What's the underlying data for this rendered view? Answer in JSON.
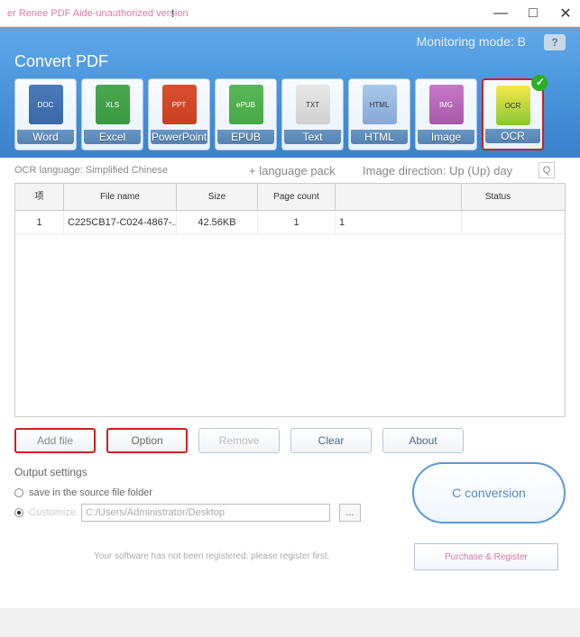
{
  "title": "er Renee PDF Aide-unauthorized version",
  "title_mark": "!",
  "monitor_mode": "Monitoring mode: B",
  "help_icon": "?",
  "convert_title": "Convert PDF",
  "formats": [
    {
      "label": "Word",
      "badge": "DOC"
    },
    {
      "label": "Excel",
      "badge": "XLS"
    },
    {
      "label": "PowerPoint",
      "badge": "PPT"
    },
    {
      "label": "EPUB",
      "badge": "ePUB"
    },
    {
      "label": "Text",
      "badge": "TXT"
    },
    {
      "label": "HTML",
      "badge": "HTML"
    },
    {
      "label": "Image",
      "badge": "IMG"
    },
    {
      "label": "OCR",
      "badge": "OCR"
    }
  ],
  "ocr_lang_label": "OCR language: Simplified Chinese",
  "lang_pack": "+ language pack",
  "img_dir": "Image direction: Up (Up) day",
  "dir_q": "Q",
  "table": {
    "headers": [
      "项",
      "File name",
      "Size",
      "Page count",
      "",
      "Status"
    ],
    "rows": [
      {
        "c1": "1",
        "c2": "C225CB17-C024-4867-...",
        "c3": "42.56KB",
        "c4": "1",
        "c5": "1",
        "c6": ""
      }
    ]
  },
  "buttons": {
    "add": "Add file",
    "option": "Option",
    "remove": "Remove",
    "clear": "Clear",
    "about": "About"
  },
  "output": {
    "title": "Output settings",
    "save_source": "save in the source file folder",
    "custom": "Customize",
    "path": "C:/Users/Administrator/Desktop",
    "browse": "..."
  },
  "convert_btn": "C conversion",
  "reg_msg": "Your software has not been registered: please register first.",
  "reg_btn": "Purchase & Register"
}
